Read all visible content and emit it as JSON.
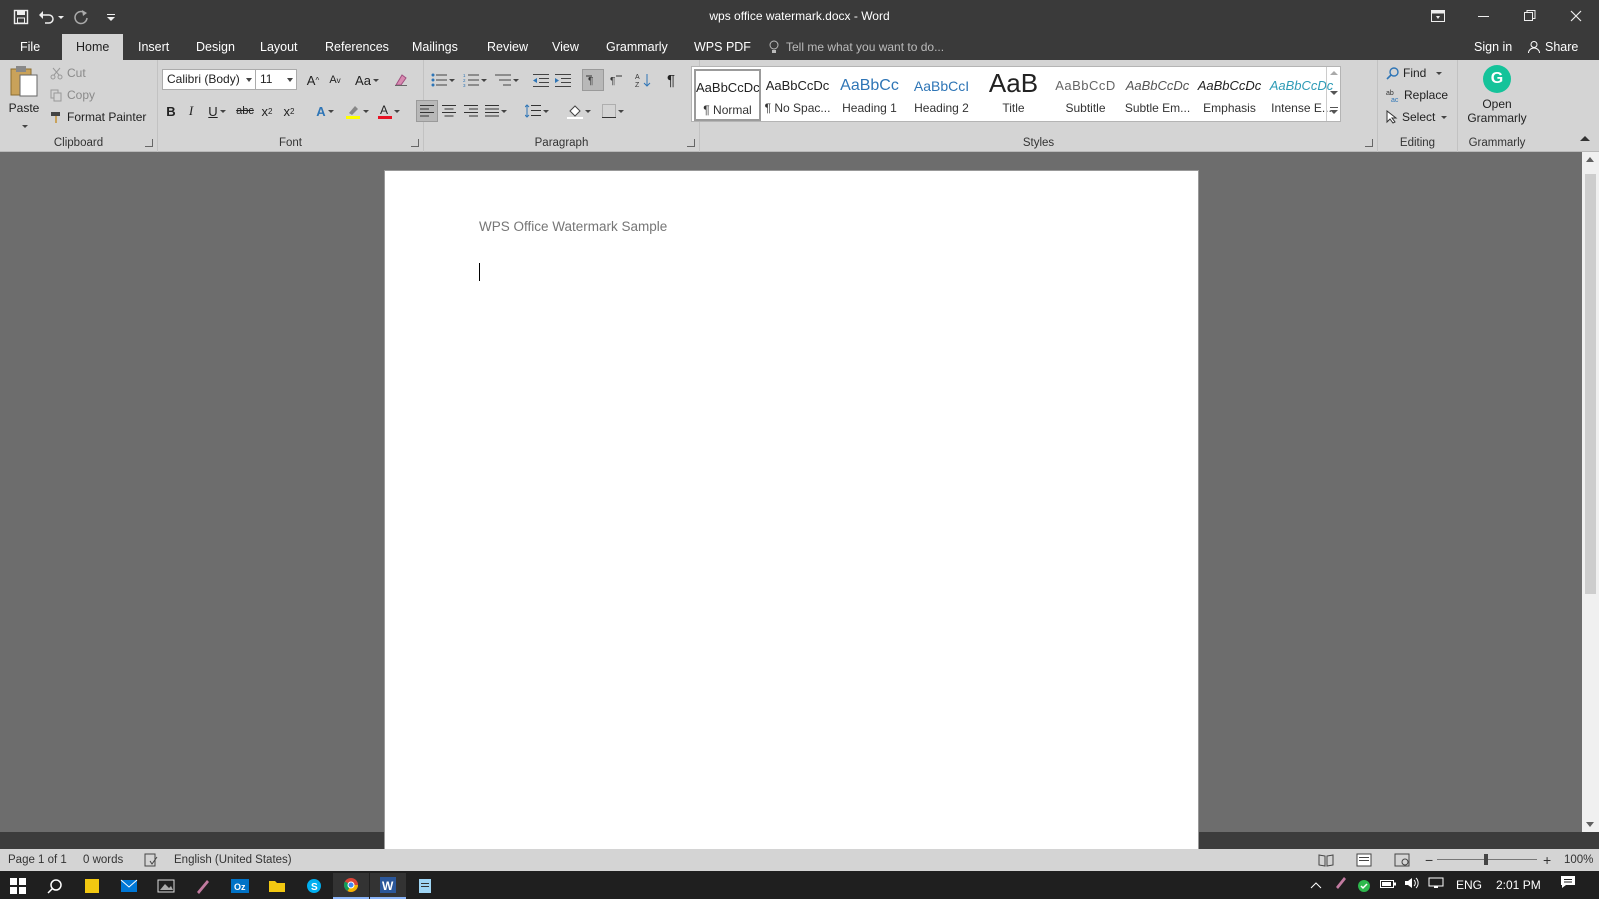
{
  "window": {
    "title": "wps office watermark.docx - Word"
  },
  "tabs": [
    {
      "label": "File"
    },
    {
      "label": "Home"
    },
    {
      "label": "Insert"
    },
    {
      "label": "Design"
    },
    {
      "label": "Layout"
    },
    {
      "label": "References"
    },
    {
      "label": "Mailings"
    },
    {
      "label": "Review"
    },
    {
      "label": "View"
    },
    {
      "label": "Grammarly"
    },
    {
      "label": "WPS PDF"
    }
  ],
  "tell_me": "Tell me what you want to do...",
  "account": {
    "sign_in": "Sign in",
    "share": "Share"
  },
  "clipboard": {
    "paste": "Paste",
    "cut": "Cut",
    "copy": "Copy",
    "format_painter": "Format Painter",
    "label": "Clipboard"
  },
  "font": {
    "name": "Calibri (Body)",
    "size": "11",
    "label": "Font",
    "case_label": "Aa"
  },
  "paragraph": {
    "label": "Paragraph"
  },
  "styles": {
    "label": "Styles",
    "items": [
      {
        "sample": "AaBbCcDc",
        "name": "¶ Normal"
      },
      {
        "sample": "AaBbCcDc",
        "name": "¶ No Spac..."
      },
      {
        "sample": "AaBbCc",
        "name": "Heading 1"
      },
      {
        "sample": "AaBbCcI",
        "name": "Heading 2"
      },
      {
        "sample": "AaB",
        "name": "Title"
      },
      {
        "sample": "AaBbCcD",
        "name": "Subtitle"
      },
      {
        "sample": "AaBbCcDc",
        "name": "Subtle Em..."
      },
      {
        "sample": "AaBbCcDc",
        "name": "Emphasis"
      },
      {
        "sample": "AaBbCcDc",
        "name": "Intense E..."
      }
    ]
  },
  "editing": {
    "find": "Find",
    "replace": "Replace",
    "select": "Select",
    "label": "Editing"
  },
  "grammarly": {
    "open_line1": "Open",
    "open_line2": "Grammarly",
    "label": "Grammarly"
  },
  "document": {
    "text": "WPS Office Watermark Sample"
  },
  "status": {
    "page": "Page 1 of 1",
    "words": "0 words",
    "language": "English (United States)",
    "zoom": "100%"
  },
  "taskbar": {
    "language": "ENG",
    "time": "2:01 PM"
  },
  "colors": {
    "title_bar": "#3a3a3a",
    "ribbon": "#d4d4d4",
    "canvas": "#6d6d6d",
    "grammarly": "#15c39a",
    "font_color_accent": "#e81123",
    "highlight_accent": "#ffff00"
  }
}
